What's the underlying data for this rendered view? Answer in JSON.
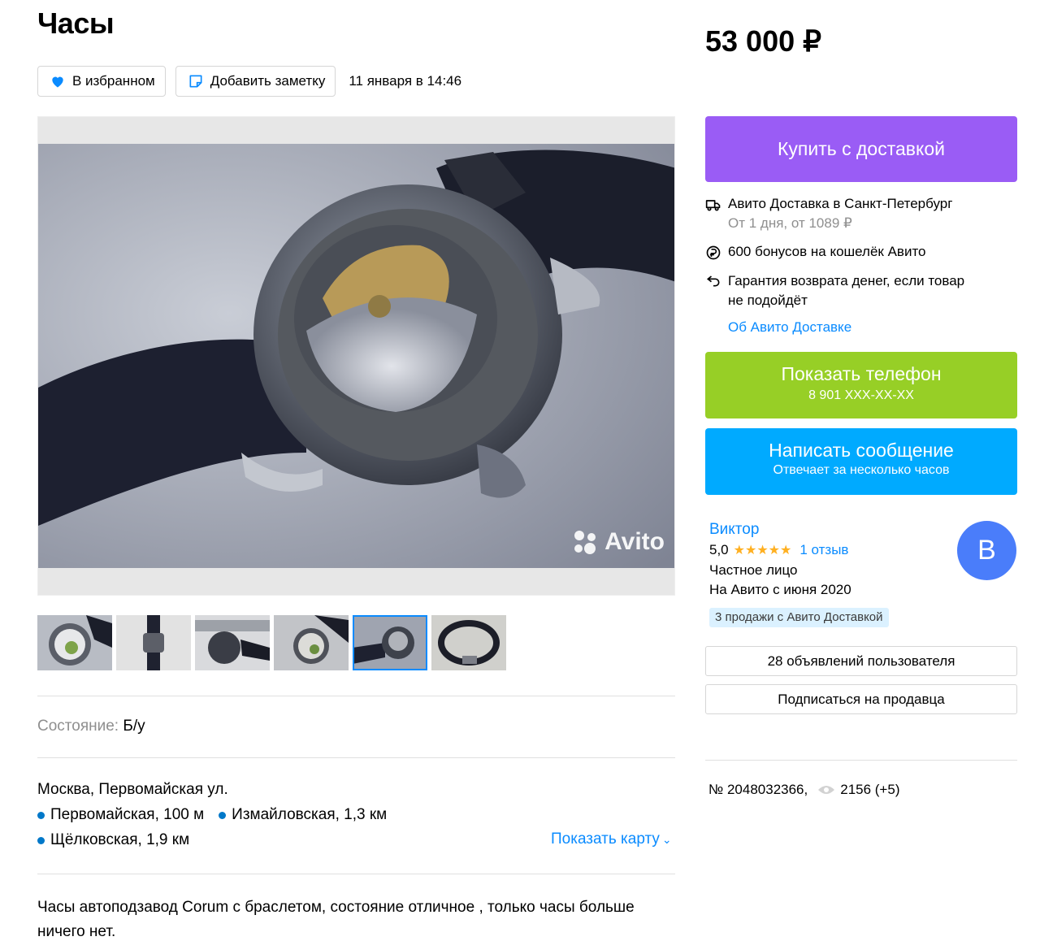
{
  "item": {
    "title": "Часы",
    "price": "53 000 ₽",
    "date": "11 января в 14:46",
    "favorite_label": "В избранном",
    "note_label": "Добавить заметку",
    "watermark": "Avito"
  },
  "details": {
    "condition_label": "Состояние:",
    "condition_value": "Б/у",
    "address": "Москва, Первомайская ул.",
    "metro": [
      {
        "name": "Первомайская, 100 м"
      },
      {
        "name": "Измайловская, 1,3 км"
      },
      {
        "name": "Щёлковская, 1,9 км"
      }
    ],
    "show_map": "Показать карту",
    "description": "Часы автоподзавод Corum с браслетом, состояние отличное , только часы больше ничего нет."
  },
  "delivery": {
    "buy_label": "Купить с доставкой",
    "city_line": "Авито Доставка в Санкт-Петербург",
    "terms": "От 1 дня, от 1089 ₽",
    "bonus": "600 бонусов на кошелёк Авито",
    "guarantee": "Гарантия возврата денег, если товар не подойдёт",
    "about_link": "Об Авито Доставке"
  },
  "contact": {
    "phone_label": "Показать телефон",
    "phone_number": "8 901 XXX-XX-XX",
    "message_label": "Написать сообщение",
    "message_sub": "Отвечает за несколько часов"
  },
  "seller": {
    "name": "Виктор",
    "rating": "5,0",
    "stars": "★★★★★",
    "reviews": "1 отзыв",
    "type": "Частное лицо",
    "since": "На Авито с июня 2020",
    "badge": "3 продажи с Авито Доставкой",
    "avatar_letter": "В",
    "ads_button": "28 объявлений пользователя",
    "subscribe_button": "Подписаться на продавца"
  },
  "meta": {
    "ad_number": "№ 2048032366,",
    "views": "2156 (+5)"
  },
  "colors": {
    "buy": "#9a5cf5",
    "phone": "#97cf26",
    "message": "#00aaff",
    "link": "#0a8bff",
    "avatar": "#4a7dfa"
  }
}
